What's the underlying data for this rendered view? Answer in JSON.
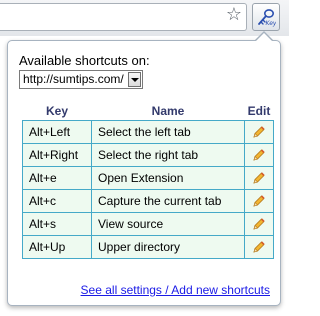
{
  "browser": {
    "bookmark_star_icon": "star-icon",
    "extension_icon": "key-icon"
  },
  "popup": {
    "available_label": "Available shortcuts on:",
    "site_select": {
      "selected": "http://sumtips.com/"
    },
    "table": {
      "headers": {
        "key": "Key",
        "name": "Name",
        "edit": "Edit"
      },
      "rows": [
        {
          "key": "Alt+Left",
          "name": "Select the left tab"
        },
        {
          "key": "Alt+Right",
          "name": "Select the right tab"
        },
        {
          "key": "Alt+e",
          "name": "Open Extension"
        },
        {
          "key": "Alt+c",
          "name": "Capture the current tab"
        },
        {
          "key": "Alt+s",
          "name": "View source"
        },
        {
          "key": "Alt+Up",
          "name": "Upper directory"
        }
      ],
      "edit_icon": "pencil-icon"
    },
    "settings_link": "See all settings / Add new shortcuts"
  },
  "colors": {
    "header_text": "#333a6c",
    "cell_border": "#45a9c8",
    "cell_background": "#eefaf0",
    "link": "#1a1ae6"
  }
}
